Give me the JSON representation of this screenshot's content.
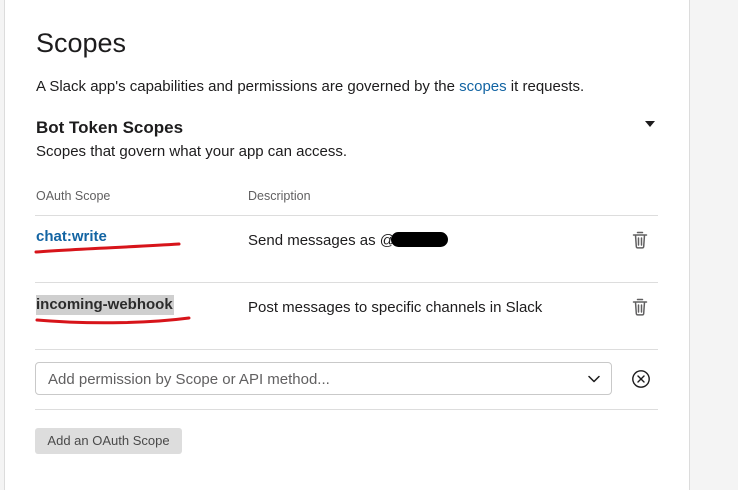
{
  "page": {
    "title": "Scopes",
    "intro_before": "A Slack app's capabilities and permissions are governed by the ",
    "intro_link": "scopes",
    "intro_after": " it requests."
  },
  "section": {
    "heading": "Bot Token Scopes",
    "subheading": "Scopes that govern what your app can access.",
    "columns": {
      "scope": "OAuth Scope",
      "description": "Description"
    }
  },
  "scopes": [
    {
      "name": "chat:write",
      "description": "Send messages as @",
      "description_redacted": true
    },
    {
      "name": "incoming-webhook",
      "description": "Post messages to specific channels in Slack",
      "highlighted": true
    }
  ],
  "add_permission": {
    "placeholder": "Add permission by Scope or API method..."
  },
  "add_scope_button": "Add an OAuth Scope",
  "colors": {
    "link": "#1264a3",
    "annotation_red": "#d7141a",
    "button_bg": "#dddddd"
  },
  "icons": {
    "collapse": "caret-down-icon",
    "delete": "trash-icon",
    "select": "chevron-down-icon",
    "clear": "circle-x-icon"
  }
}
